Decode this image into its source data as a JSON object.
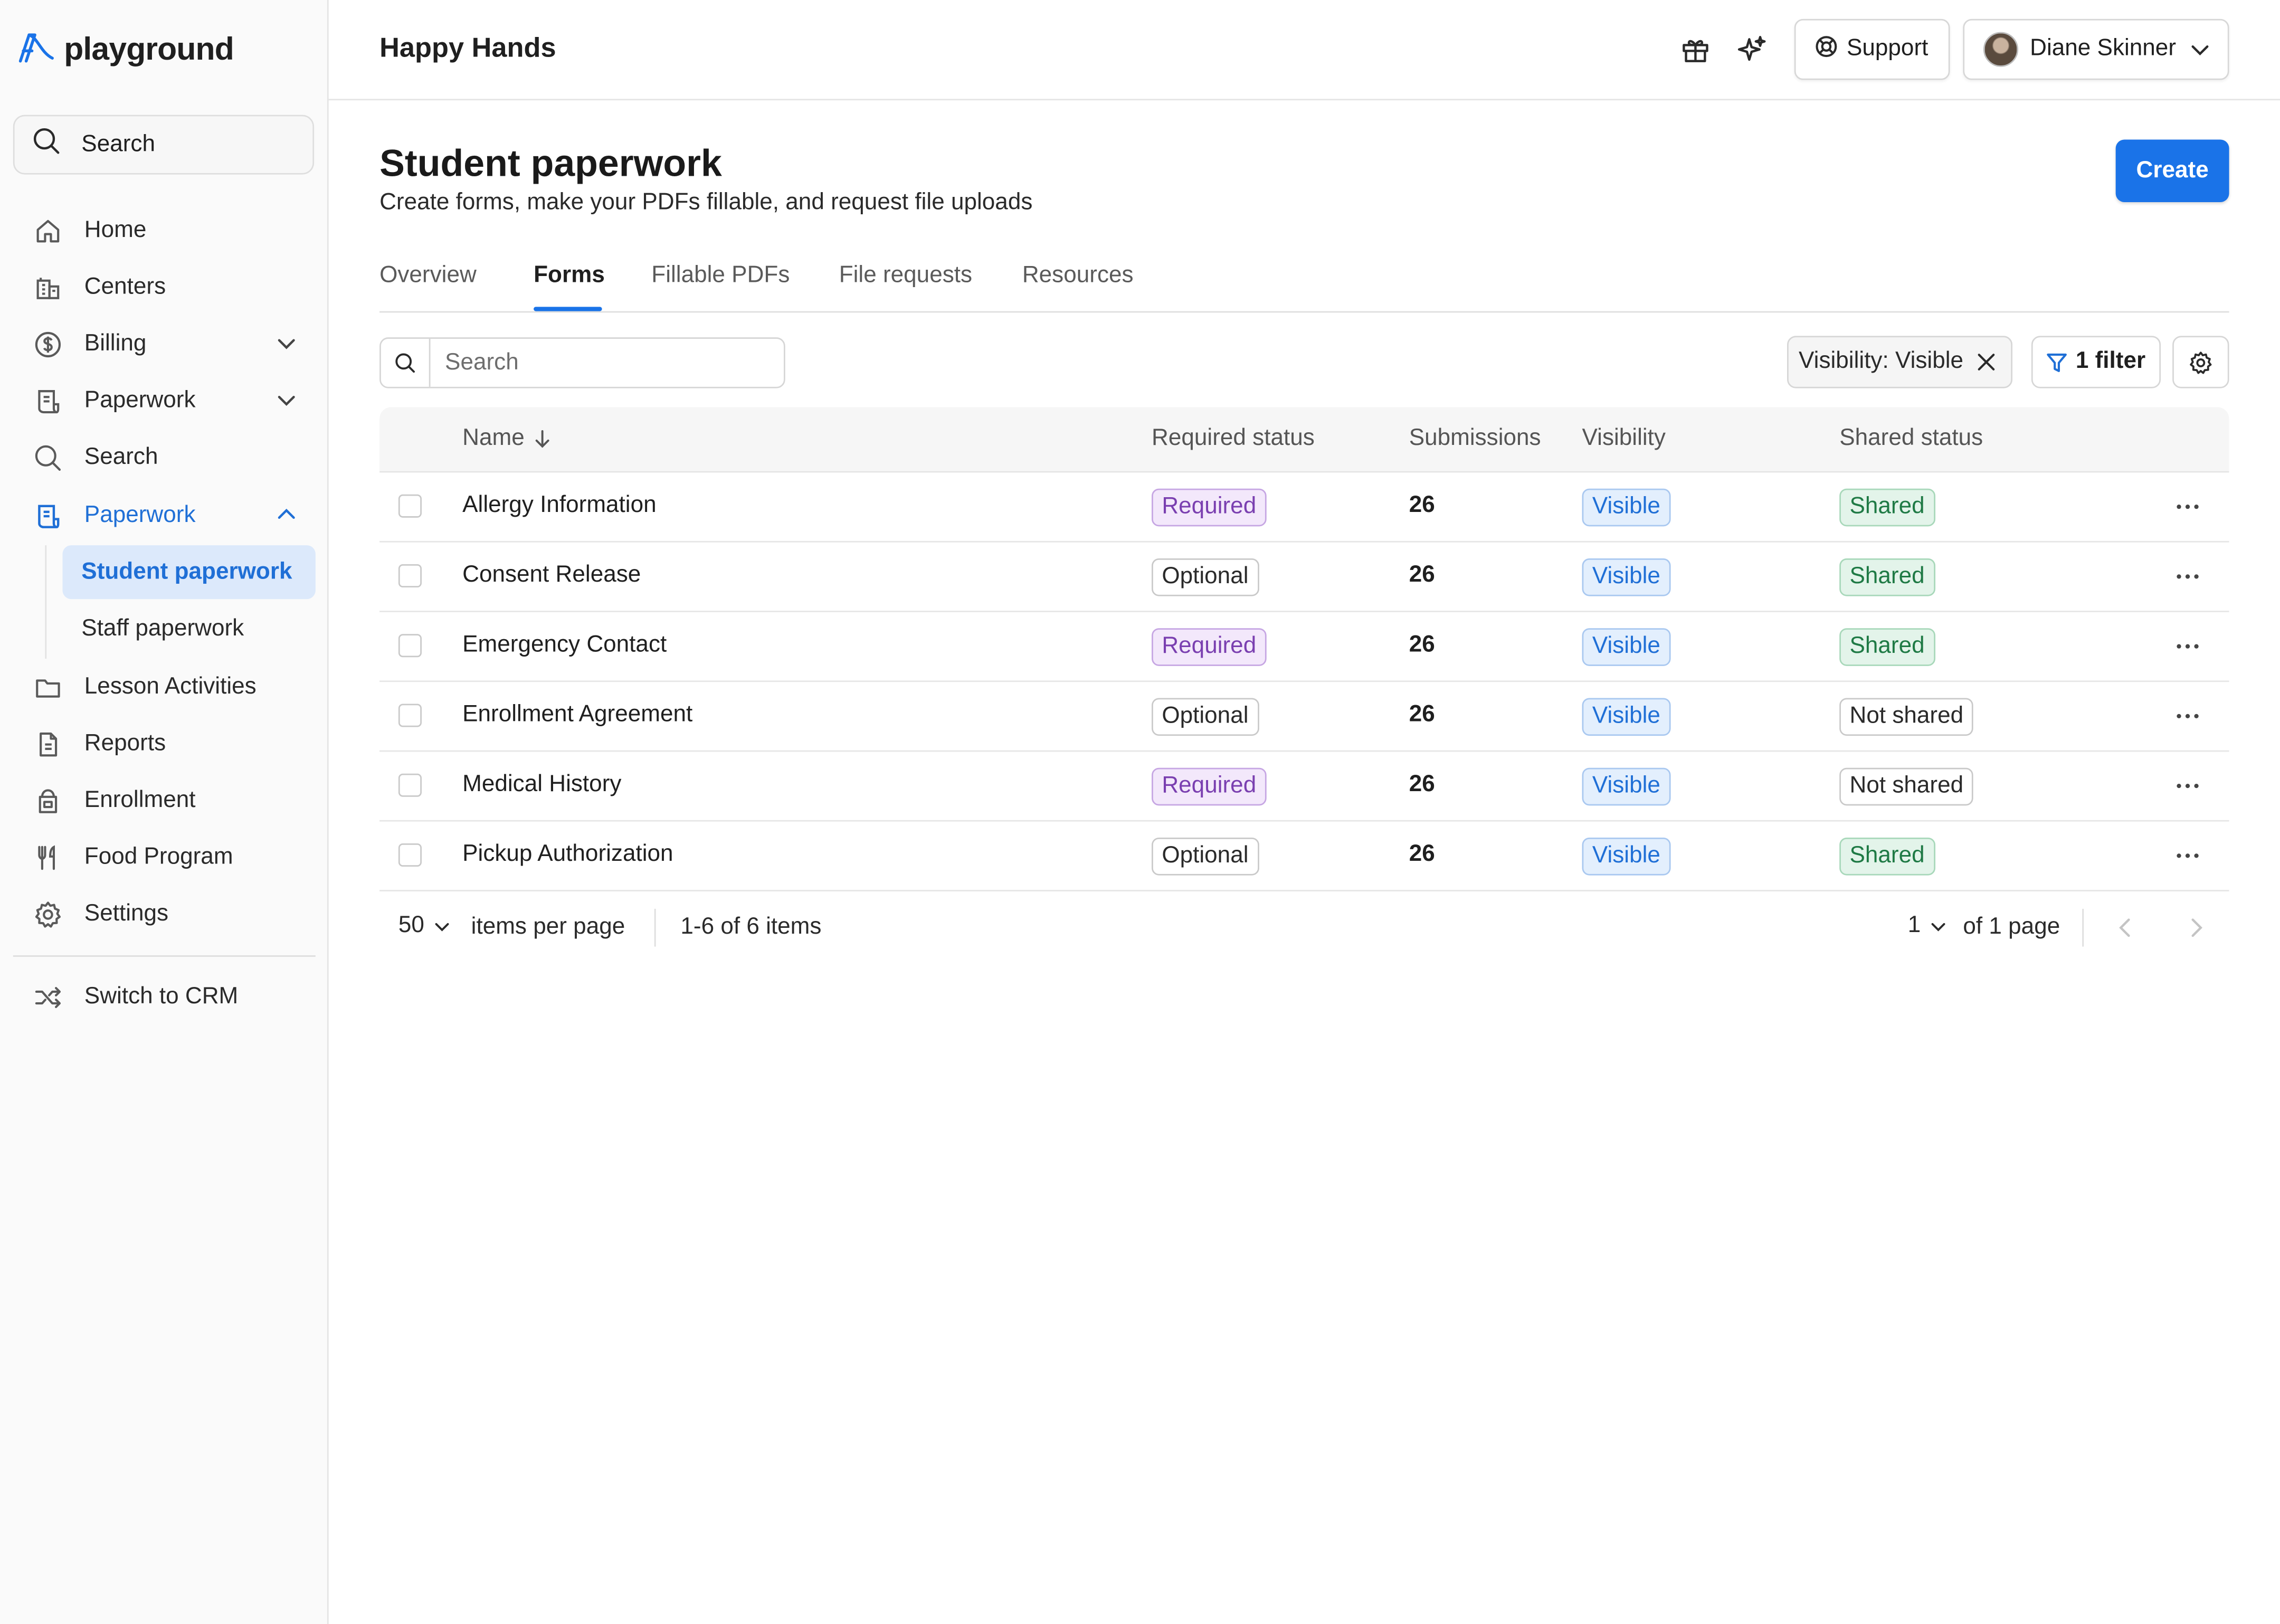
{
  "brand": {
    "logo_text": "playground",
    "accent": "#1a73e8"
  },
  "sidebar": {
    "search_label": "Search",
    "items": [
      {
        "label": "Home",
        "icon": "home-icon"
      },
      {
        "label": "Centers",
        "icon": "building-icon"
      },
      {
        "label": "Billing",
        "icon": "dollar-icon",
        "expandable": true
      },
      {
        "label": "Paperwork",
        "icon": "document-icon",
        "expandable": true
      },
      {
        "label": "Search",
        "icon": "search-icon"
      },
      {
        "label": "Paperwork",
        "icon": "document-icon",
        "expanded": true,
        "active": true
      },
      {
        "label": "Lesson Activities",
        "icon": "folder-icon"
      },
      {
        "label": "Reports",
        "icon": "report-icon"
      },
      {
        "label": "Enrollment",
        "icon": "enrollment-icon"
      },
      {
        "label": "Food Program",
        "icon": "utensils-icon"
      },
      {
        "label": "Settings",
        "icon": "gear-icon"
      }
    ],
    "subitems": [
      {
        "label": "Student paperwork",
        "selected": true
      },
      {
        "label": "Staff paperwork"
      }
    ],
    "switch_label": "Switch to CRM"
  },
  "header": {
    "org_title": "Happy Hands",
    "support_label": "Support",
    "user_name": "Diane Skinner"
  },
  "page": {
    "title": "Student paperwork",
    "subtitle": "Create forms, make your PDFs fillable, and request file uploads",
    "create_label": "Create",
    "tabs": [
      "Overview",
      "Forms",
      "Fillable PDFs",
      "File requests",
      "Resources"
    ],
    "active_tab": "Forms"
  },
  "toolbar": {
    "search_placeholder": "Search",
    "filter_chip": "Visibility: Visible",
    "filter_button": "1 filter"
  },
  "table": {
    "headers": {
      "name": "Name",
      "required": "Required status",
      "submissions": "Submissions",
      "visibility": "Visibility",
      "shared": "Shared status"
    },
    "rows": [
      {
        "name": "Allergy Information",
        "required": "Required",
        "submissions": "26",
        "visibility": "Visible",
        "shared": "Shared"
      },
      {
        "name": "Consent Release",
        "required": "Optional",
        "submissions": "26",
        "visibility": "Visible",
        "shared": "Shared"
      },
      {
        "name": "Emergency Contact",
        "required": "Required",
        "submissions": "26",
        "visibility": "Visible",
        "shared": "Shared"
      },
      {
        "name": "Enrollment Agreement",
        "required": "Optional",
        "submissions": "26",
        "visibility": "Visible",
        "shared": "Not shared"
      },
      {
        "name": "Medical History",
        "required": "Required",
        "submissions": "26",
        "visibility": "Visible",
        "shared": "Not shared"
      },
      {
        "name": "Pickup Authorization",
        "required": "Optional",
        "submissions": "26",
        "visibility": "Visible",
        "shared": "Shared"
      }
    ]
  },
  "pagination": {
    "per_page": "50",
    "per_page_label": "items per page",
    "range": "1-6 of 6 items",
    "current_page": "1",
    "of_pages": "of 1 page"
  }
}
